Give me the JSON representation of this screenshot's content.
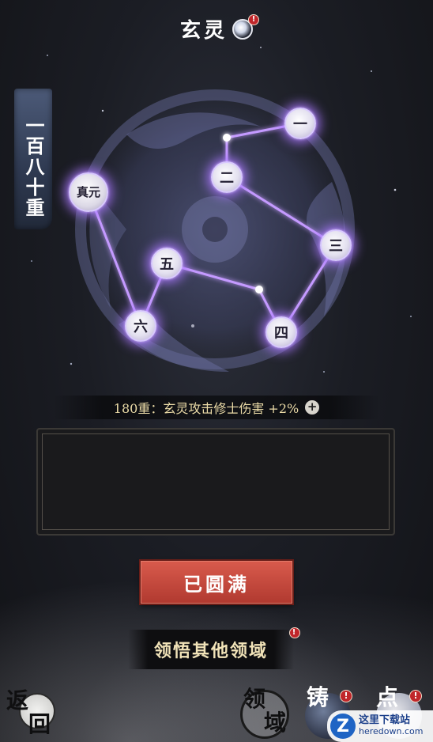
{
  "header": {
    "title": "玄灵",
    "alert_mark": "!"
  },
  "realm_level": "一百八十重",
  "nodes": {
    "origin": "真元",
    "one": "一",
    "two": "二",
    "three": "三",
    "four": "四",
    "five": "五",
    "six": "六"
  },
  "bonus": {
    "text": "180重：玄灵攻击修士伤害 +2%",
    "plus_symbol": "+"
  },
  "description": "",
  "buttons": {
    "complete": "已圆满",
    "comprehend": "领悟其他领域"
  },
  "bottom_nav": {
    "back": [
      "返",
      "回"
    ],
    "domain": [
      "领",
      "域"
    ],
    "forge": "铸",
    "point": "点"
  },
  "watermark": {
    "logo": "Z",
    "name": "这里下载站",
    "url": "heredown.com"
  },
  "colors": {
    "constellation_glow": "#a878ff",
    "alert": "#c0262a",
    "complete_button": "#c4473b",
    "bonus_text": "#ecdca8"
  },
  "icons": {
    "title_orb": "spirit-orb-icon",
    "alert": "exclamation-badge-icon",
    "plus": "plus-circle-icon"
  }
}
